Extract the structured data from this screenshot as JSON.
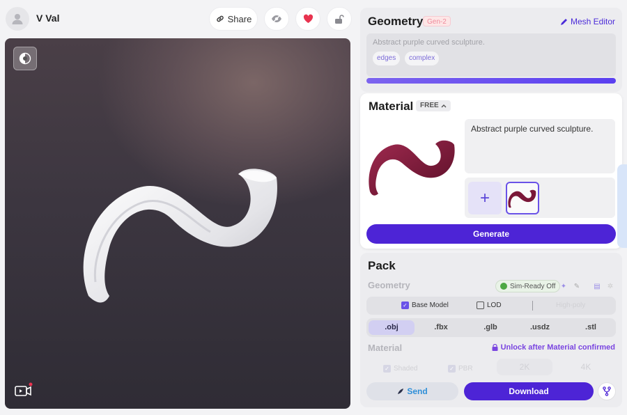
{
  "header": {
    "username": "V Val",
    "share_label": "Share",
    "icons": [
      "user-icon",
      "link-icon",
      "eye-off-icon",
      "heart-icon",
      "unlock-icon"
    ],
    "heart_color": "#e8334f"
  },
  "viewport": {
    "icons": [
      "shading-toggle-icon",
      "record-video-icon"
    ],
    "model_color": "#f1f1f3"
  },
  "geometry": {
    "title": "Geometry",
    "badge": "Gen-2",
    "mesh_editor_label": "Mesh Editor",
    "prompt": "Abstract purple curved sculpture.",
    "tags": [
      "edges",
      "complex"
    ],
    "progress": 1.0
  },
  "material": {
    "title": "Material",
    "badge": "FREE",
    "prompt": "Abstract purple curved sculpture.",
    "generate_label": "Generate",
    "model_color": "#7a1738"
  },
  "pack": {
    "title": "Pack",
    "geometry_label": "Geometry",
    "simready_label": "Sim-Ready Off",
    "options": {
      "base_model": "Base Model",
      "base_model_checked": true,
      "lod": "LOD",
      "lod_checked": false,
      "high_poly": "High-poly"
    },
    "formats": [
      ".obj",
      ".fbx",
      ".glb",
      ".usdz",
      ".stl"
    ],
    "selected_format": ".obj",
    "material_label": "Material",
    "unlock_label": "Unlock after Material confirmed",
    "material_options": [
      "Shaded",
      "PBR"
    ],
    "resolutions": [
      "2K",
      "4K"
    ],
    "send_label": "Send",
    "download_label": "Download"
  },
  "accent_color": "#4d24d6"
}
